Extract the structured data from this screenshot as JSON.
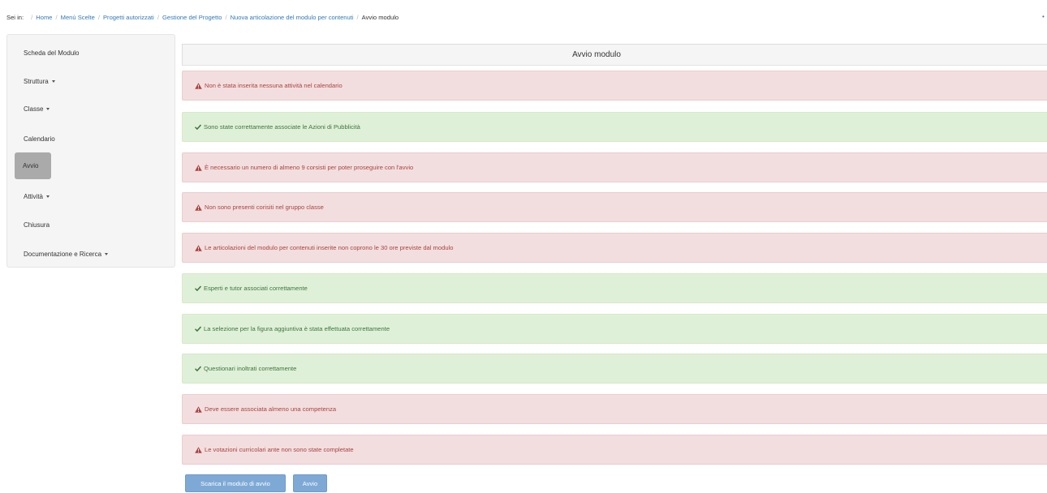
{
  "breadcrumb": {
    "prefix": "Sei in:",
    "items": [
      {
        "label": "Home"
      },
      {
        "label": "Menù Scelte"
      },
      {
        "label": "Progetti autorizzati"
      },
      {
        "label": "Gestione del Progetto"
      },
      {
        "label": "Nuova articolazione del modulo per contenuti"
      },
      {
        "label": "Avvio modulo",
        "active": true
      }
    ]
  },
  "sidebar": {
    "items": [
      {
        "label": "Scheda del Modulo",
        "dropdown": false
      },
      {
        "label": "Struttura",
        "dropdown": true
      },
      {
        "label": "Classe",
        "dropdown": true
      },
      {
        "label": "Calendario",
        "dropdown": false
      },
      {
        "label": "Avvio",
        "dropdown": false,
        "active": true
      },
      {
        "label": "Attività",
        "dropdown": true
      },
      {
        "label": "Chiusura",
        "dropdown": false
      },
      {
        "label": "Documentazione e Ricerca",
        "dropdown": true
      }
    ]
  },
  "panel": {
    "title": "Avvio modulo",
    "alerts": [
      {
        "type": "danger",
        "icon": "warning-icon",
        "text": "Non è stata inserita nessuna attività nel calendario"
      },
      {
        "type": "success",
        "icon": "check-icon",
        "text": "Sono state correttamente associate le Azioni di Pubblicità"
      },
      {
        "type": "danger",
        "icon": "warning-icon",
        "text": "È necessario un numero di almeno 9 corsisti per poter proseguire con l'avvio"
      },
      {
        "type": "danger",
        "icon": "warning-icon",
        "text": "Non sono presenti corisiti nel gruppo classe"
      },
      {
        "type": "danger",
        "icon": "warning-icon",
        "text": "Le articolazioni del modulo per contenuti inserite non coprono le 30 ore previste dal modulo"
      },
      {
        "type": "success",
        "icon": "check-icon",
        "text": "Esperti e tutor associati correttamente"
      },
      {
        "type": "success",
        "icon": "check-icon",
        "text": "La selezione per la figura aggiuntiva è stata effettuata correttamente"
      },
      {
        "type": "success",
        "icon": "check-icon",
        "text": "Questionari inoltrati correttamente"
      },
      {
        "type": "danger",
        "icon": "warning-icon",
        "text": "Deve essere associata almeno una competenza"
      },
      {
        "type": "danger",
        "icon": "warning-icon",
        "text": "Le votazioni curricolari ante non sono state completate"
      }
    ]
  },
  "actions": {
    "download_label": "Scarica il modulo di avvio",
    "start_label": "Avvio"
  },
  "colors": {
    "link": "#337ab7",
    "danger_bg": "#f2dede",
    "danger_text": "#a94442",
    "success_bg": "#dff0d8",
    "success_text": "#3c763d",
    "button_bg": "#7fa9d5",
    "active_nav_bg": "#aaaaaa"
  }
}
